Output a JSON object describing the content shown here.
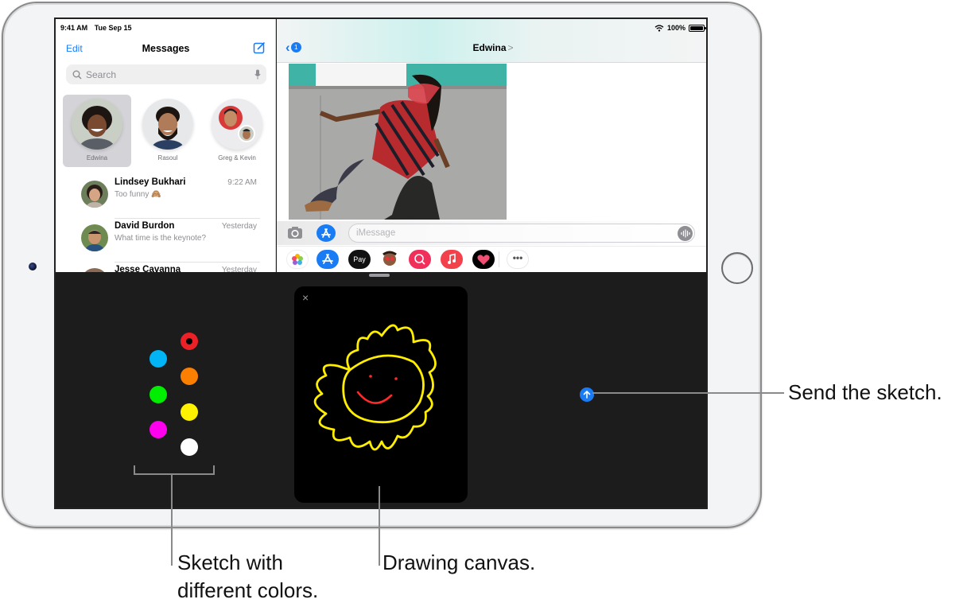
{
  "status_bar": {
    "time": "9:41 AM",
    "date": "Tue Sep 15",
    "battery": "100%",
    "battery_level": 1.0
  },
  "sidebar": {
    "edit_label": "Edit",
    "title": "Messages",
    "search_placeholder": "Search",
    "pinned": [
      {
        "name": "Edwina",
        "selected": true
      },
      {
        "name": "Rasoul",
        "selected": false
      },
      {
        "name": "Greg & Kevin",
        "selected": false
      }
    ],
    "conversations": [
      {
        "name": "Lindsey Bukhari",
        "time": "9:22 AM",
        "preview": "Too funny 🙈"
      },
      {
        "name": "David Burdon",
        "time": "Yesterday",
        "preview": "What time is the keynote?"
      },
      {
        "name": "Jesse Cavanna",
        "time": "Yesterday",
        "preview": ""
      }
    ]
  },
  "conversation": {
    "back_badge": "1",
    "contact_name": "Edwina",
    "title_chevron": ">",
    "input_placeholder": "iMessage",
    "app_drawer": [
      "Photos",
      "App Store",
      "Apple Pay",
      "Memoji",
      "Images Search",
      "Music",
      "Digital Touch",
      "More"
    ]
  },
  "sketch": {
    "close_label": "×",
    "colors": [
      {
        "name": "red",
        "hex": "#ec2027",
        "selected": true
      },
      {
        "name": "cyan",
        "hex": "#00b4f6"
      },
      {
        "name": "orange",
        "hex": "#fb7f00"
      },
      {
        "name": "green",
        "hex": "#00ee00"
      },
      {
        "name": "yellow",
        "hex": "#fff200"
      },
      {
        "name": "magenta",
        "hex": "#ff00ee"
      },
      {
        "name": "white",
        "hex": "#ffffff"
      }
    ],
    "accent": "#1a7cf5"
  },
  "callouts": {
    "colors": "Sketch with different colors.",
    "colors_line1": "Sketch with",
    "colors_line2": "different colors.",
    "canvas": "Drawing canvas.",
    "send": "Send the sketch."
  }
}
